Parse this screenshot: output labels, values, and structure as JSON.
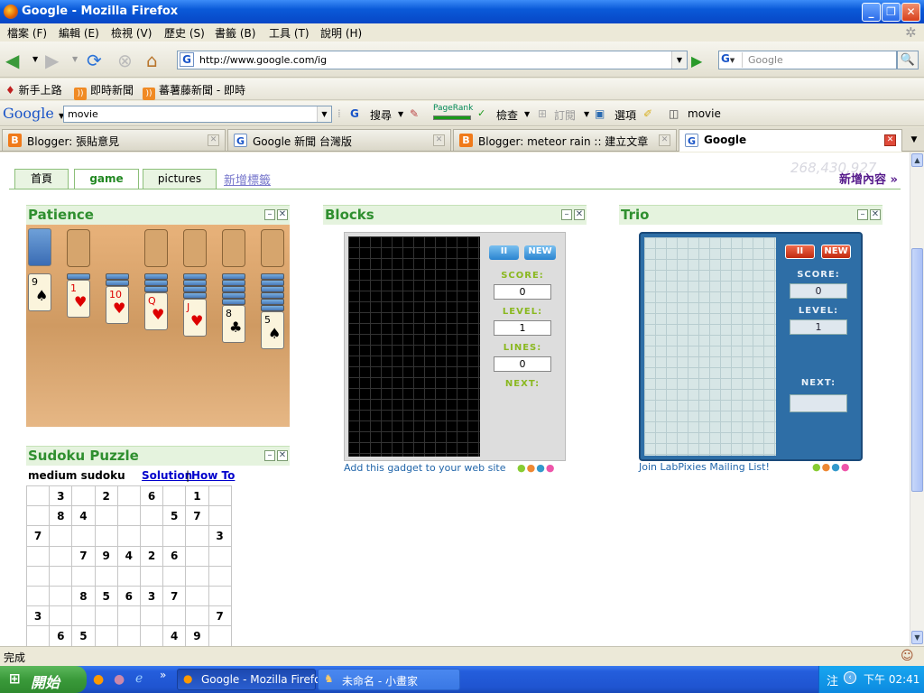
{
  "window": {
    "title": "Google - Mozilla Firefox"
  },
  "menu": [
    "檔案 (F)",
    "編輯 (E)",
    "檢視 (V)",
    "歷史 (S)",
    "書籤 (B)",
    "工具 (T)",
    "說明 (H)"
  ],
  "nav": {
    "url": "http://www.google.com/ig",
    "search_placeholder": "Google"
  },
  "bookmarks": [
    "新手上路",
    "即時新聞",
    "蕃薯藤新聞 - 即時"
  ],
  "gtoolbar": {
    "logo": "Google",
    "query": "movie",
    "search_label": "搜尋",
    "pagerank_label": "PageRank",
    "check_label": "檢查",
    "subscribe_label": "訂閱",
    "options_label": "選項",
    "movie_label": "movie"
  },
  "tabs": [
    {
      "label": "Blogger: 張貼意見",
      "icon": "blogger"
    },
    {
      "label": "Google 新聞 台灣版",
      "icon": "google"
    },
    {
      "label": "Blogger: meteor rain :: 建立文章",
      "icon": "blogger"
    },
    {
      "label": "Google",
      "icon": "google",
      "active": true
    }
  ],
  "igoogle": {
    "tabs": [
      "首頁",
      "game",
      "pictures"
    ],
    "add_tab": "新增標籤",
    "add_content": "新增內容 »",
    "counter": "268,430,927"
  },
  "patience": {
    "title": "Patience",
    "columns": [
      {
        "rank": "9",
        "suit": "♠",
        "color": "black",
        "backs": 0
      },
      {
        "rank": "1",
        "suit": "♥",
        "color": "red",
        "backs": 1
      },
      {
        "rank": "10",
        "suit": "♥",
        "color": "red",
        "backs": 2
      },
      {
        "rank": "Q",
        "suit": "♥",
        "color": "red",
        "backs": 3
      },
      {
        "rank": "J",
        "suit": "♥",
        "color": "red",
        "backs": 4
      },
      {
        "rank": "8",
        "suit": "♣",
        "color": "black",
        "backs": 5
      },
      {
        "rank": "5",
        "suit": "♠",
        "color": "black",
        "backs": 6
      }
    ]
  },
  "sudoku": {
    "title": "Sudoku Puzzle",
    "difficulty": "medium sudoku",
    "solution_link": "Solution",
    "separator": "|",
    "howto_link": "How To",
    "grid": [
      [
        "",
        "3",
        "",
        "2",
        "",
        "6",
        "",
        "1",
        ""
      ],
      [
        "",
        "8",
        "4",
        "",
        "",
        "",
        "5",
        "7",
        ""
      ],
      [
        "7",
        "",
        "",
        "",
        "",
        "",
        "",
        "",
        "3"
      ],
      [
        "",
        "",
        "7",
        "9",
        "4",
        "2",
        "6",
        "",
        ""
      ],
      [
        "",
        "",
        "",
        "",
        "",
        "",
        "",
        "",
        ""
      ],
      [
        "",
        "",
        "8",
        "5",
        "6",
        "3",
        "7",
        "",
        ""
      ],
      [
        "3",
        "",
        "",
        "",
        "",
        "",
        "",
        "",
        "7"
      ],
      [
        "",
        "6",
        "5",
        "",
        "",
        "",
        "4",
        "9",
        ""
      ]
    ]
  },
  "blocks": {
    "title": "Blocks",
    "pause": "II",
    "new": "NEW",
    "score_label": "SCORE:",
    "score": "0",
    "level_label": "LEVEL:",
    "level": "1",
    "lines_label": "LINES:",
    "lines": "0",
    "next_label": "NEXT:",
    "footer_link": "Add this gadget to your web site"
  },
  "trio": {
    "title": "Trio",
    "pause": "II",
    "new": "NEW",
    "score_label": "SCORE:",
    "score": "0",
    "level_label": "LEVEL:",
    "level": "1",
    "next_label": "NEXT:",
    "footer_link": "Join LabPixies Mailing List!"
  },
  "status": {
    "text": "完成"
  },
  "taskbar": {
    "start": "開始",
    "items": [
      "Google - Mozilla Firefox",
      "未命名 - 小畫家"
    ],
    "ime": "注",
    "clock": "下午 02:41"
  },
  "colors": {
    "accent_green": "#2f8f2f",
    "xp_blue": "#245edc",
    "start_green": "#3a9a3a"
  }
}
